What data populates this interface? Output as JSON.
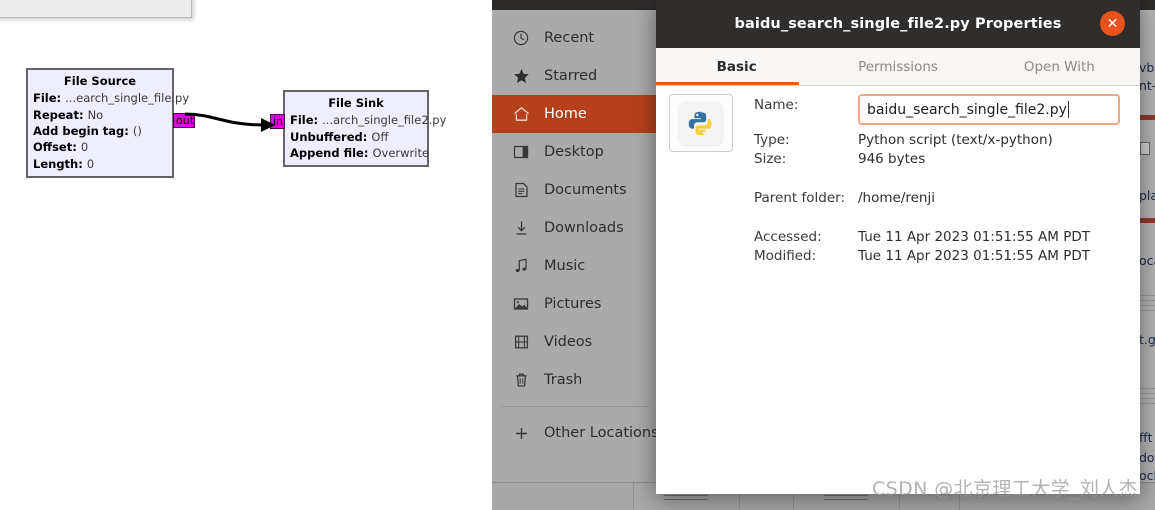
{
  "grc": {
    "blocks": [
      {
        "title": "File Source",
        "rows": [
          {
            "key": "File:",
            "value": "...earch_single_file.py"
          },
          {
            "key": "Repeat:",
            "value": "No"
          },
          {
            "key": "Add begin tag:",
            "value": "()"
          },
          {
            "key": "Offset:",
            "value": "0"
          },
          {
            "key": "Length:",
            "value": "0"
          }
        ]
      },
      {
        "title": "File Sink",
        "rows": [
          {
            "key": "File:",
            "value": "...arch_single_file2.py"
          },
          {
            "key": "Unbuffered:",
            "value": "Off"
          },
          {
            "key": "Append file:",
            "value": "Overwrite"
          }
        ]
      }
    ],
    "ports": {
      "out": "out",
      "in": "in"
    },
    "colors": {
      "block_bg": "#eeeeff",
      "block_border": "#666666",
      "port": "#e000e0"
    }
  },
  "files_window": {
    "sidebar": {
      "items": [
        {
          "label": "Recent",
          "icon": "clock-icon",
          "selected": false
        },
        {
          "label": "Starred",
          "icon": "star-icon",
          "selected": false
        },
        {
          "label": "Home",
          "icon": "home-icon",
          "selected": true
        },
        {
          "label": "Desktop",
          "icon": "desktop-icon",
          "selected": false
        },
        {
          "label": "Documents",
          "icon": "document-icon",
          "selected": false
        },
        {
          "label": "Downloads",
          "icon": "download-icon",
          "selected": false
        },
        {
          "label": "Music",
          "icon": "music-note-icon",
          "selected": false
        },
        {
          "label": "Pictures",
          "icon": "picture-icon",
          "selected": false
        },
        {
          "label": "Videos",
          "icon": "film-icon",
          "selected": false
        },
        {
          "label": "Trash",
          "icon": "trash-icon",
          "selected": false
        }
      ],
      "other_locations": {
        "label": "Other Locations",
        "icon": "plus-icon"
      },
      "selected_color": "#b5411c"
    },
    "clipped_list_fragments": [
      "vb",
      "nt-",
      "pla",
      "oca",
      "t.g",
      "fft",
      "do",
      "ock"
    ]
  },
  "properties_dialog": {
    "title": "baidu_search_single_file2.py Properties",
    "close_label": "✕",
    "tabs": [
      {
        "label": "Basic",
        "active": true
      },
      {
        "label": "Permissions",
        "active": false
      },
      {
        "label": "Open With",
        "active": false
      }
    ],
    "accent_color": "#e8591f",
    "file_icon": "python-file-icon",
    "fields": {
      "name_label": "Name:",
      "name_value": "baidu_search_single_file2.py",
      "type_label": "Type:",
      "type_value": "Python script (text/x-python)",
      "size_label": "Size:",
      "size_value": "946 bytes",
      "parent_label": "Parent folder:",
      "parent_value": "/home/renji",
      "accessed_label": "Accessed:",
      "accessed_value": "Tue 11 Apr 2023 01:51:55 AM PDT",
      "modified_label": "Modified:",
      "modified_value": "Tue 11 Apr 2023 01:51:55 AM PDT"
    }
  },
  "watermark": {
    "text": "CSDN @北京理工大学_刘人杰"
  }
}
